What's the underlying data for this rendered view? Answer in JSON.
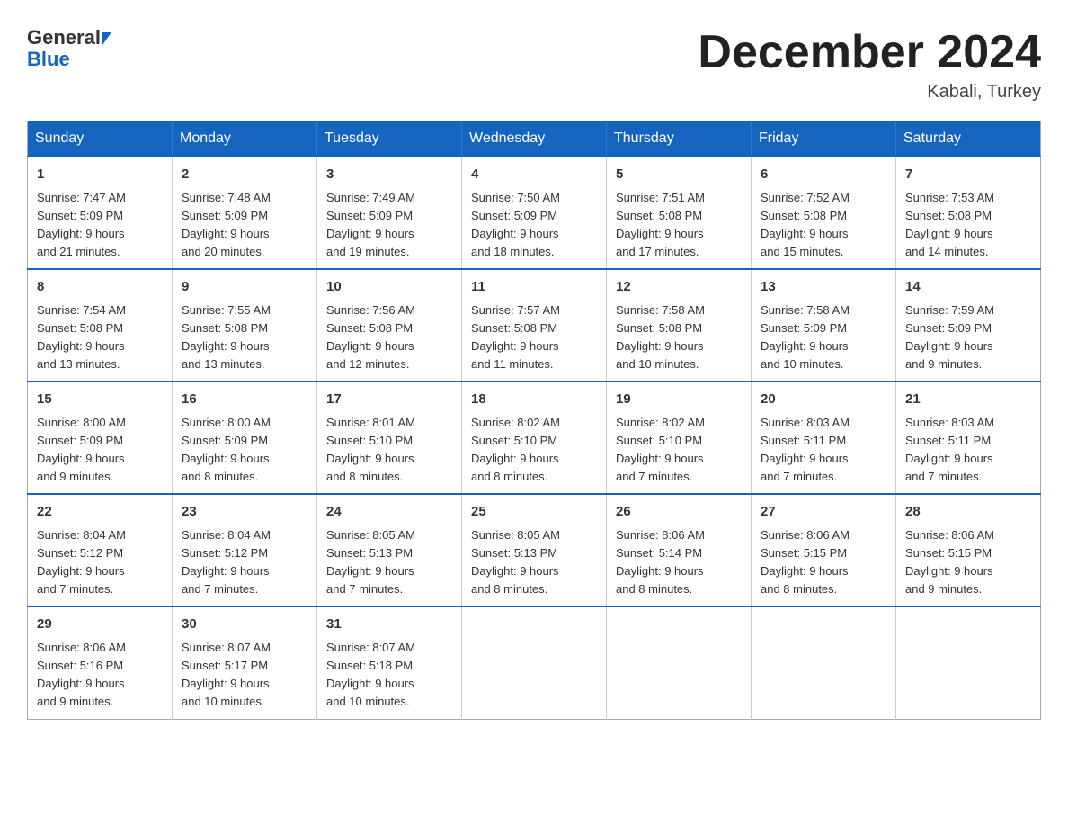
{
  "header": {
    "logo_general": "General",
    "logo_blue": "Blue",
    "month_title": "December 2024",
    "location": "Kabali, Turkey"
  },
  "days_of_week": [
    "Sunday",
    "Monday",
    "Tuesday",
    "Wednesday",
    "Thursday",
    "Friday",
    "Saturday"
  ],
  "weeks": [
    [
      {
        "day": "1",
        "sunrise": "7:47 AM",
        "sunset": "5:09 PM",
        "daylight": "9 hours and 21 minutes."
      },
      {
        "day": "2",
        "sunrise": "7:48 AM",
        "sunset": "5:09 PM",
        "daylight": "9 hours and 20 minutes."
      },
      {
        "day": "3",
        "sunrise": "7:49 AM",
        "sunset": "5:09 PM",
        "daylight": "9 hours and 19 minutes."
      },
      {
        "day": "4",
        "sunrise": "7:50 AM",
        "sunset": "5:09 PM",
        "daylight": "9 hours and 18 minutes."
      },
      {
        "day": "5",
        "sunrise": "7:51 AM",
        "sunset": "5:08 PM",
        "daylight": "9 hours and 17 minutes."
      },
      {
        "day": "6",
        "sunrise": "7:52 AM",
        "sunset": "5:08 PM",
        "daylight": "9 hours and 15 minutes."
      },
      {
        "day": "7",
        "sunrise": "7:53 AM",
        "sunset": "5:08 PM",
        "daylight": "9 hours and 14 minutes."
      }
    ],
    [
      {
        "day": "8",
        "sunrise": "7:54 AM",
        "sunset": "5:08 PM",
        "daylight": "9 hours and 13 minutes."
      },
      {
        "day": "9",
        "sunrise": "7:55 AM",
        "sunset": "5:08 PM",
        "daylight": "9 hours and 13 minutes."
      },
      {
        "day": "10",
        "sunrise": "7:56 AM",
        "sunset": "5:08 PM",
        "daylight": "9 hours and 12 minutes."
      },
      {
        "day": "11",
        "sunrise": "7:57 AM",
        "sunset": "5:08 PM",
        "daylight": "9 hours and 11 minutes."
      },
      {
        "day": "12",
        "sunrise": "7:58 AM",
        "sunset": "5:08 PM",
        "daylight": "9 hours and 10 minutes."
      },
      {
        "day": "13",
        "sunrise": "7:58 AM",
        "sunset": "5:09 PM",
        "daylight": "9 hours and 10 minutes."
      },
      {
        "day": "14",
        "sunrise": "7:59 AM",
        "sunset": "5:09 PM",
        "daylight": "9 hours and 9 minutes."
      }
    ],
    [
      {
        "day": "15",
        "sunrise": "8:00 AM",
        "sunset": "5:09 PM",
        "daylight": "9 hours and 9 minutes."
      },
      {
        "day": "16",
        "sunrise": "8:00 AM",
        "sunset": "5:09 PM",
        "daylight": "9 hours and 8 minutes."
      },
      {
        "day": "17",
        "sunrise": "8:01 AM",
        "sunset": "5:10 PM",
        "daylight": "9 hours and 8 minutes."
      },
      {
        "day": "18",
        "sunrise": "8:02 AM",
        "sunset": "5:10 PM",
        "daylight": "9 hours and 8 minutes."
      },
      {
        "day": "19",
        "sunrise": "8:02 AM",
        "sunset": "5:10 PM",
        "daylight": "9 hours and 7 minutes."
      },
      {
        "day": "20",
        "sunrise": "8:03 AM",
        "sunset": "5:11 PM",
        "daylight": "9 hours and 7 minutes."
      },
      {
        "day": "21",
        "sunrise": "8:03 AM",
        "sunset": "5:11 PM",
        "daylight": "9 hours and 7 minutes."
      }
    ],
    [
      {
        "day": "22",
        "sunrise": "8:04 AM",
        "sunset": "5:12 PM",
        "daylight": "9 hours and 7 minutes."
      },
      {
        "day": "23",
        "sunrise": "8:04 AM",
        "sunset": "5:12 PM",
        "daylight": "9 hours and 7 minutes."
      },
      {
        "day": "24",
        "sunrise": "8:05 AM",
        "sunset": "5:13 PM",
        "daylight": "9 hours and 7 minutes."
      },
      {
        "day": "25",
        "sunrise": "8:05 AM",
        "sunset": "5:13 PM",
        "daylight": "9 hours and 8 minutes."
      },
      {
        "day": "26",
        "sunrise": "8:06 AM",
        "sunset": "5:14 PM",
        "daylight": "9 hours and 8 minutes."
      },
      {
        "day": "27",
        "sunrise": "8:06 AM",
        "sunset": "5:15 PM",
        "daylight": "9 hours and 8 minutes."
      },
      {
        "day": "28",
        "sunrise": "8:06 AM",
        "sunset": "5:15 PM",
        "daylight": "9 hours and 9 minutes."
      }
    ],
    [
      {
        "day": "29",
        "sunrise": "8:06 AM",
        "sunset": "5:16 PM",
        "daylight": "9 hours and 9 minutes."
      },
      {
        "day": "30",
        "sunrise": "8:07 AM",
        "sunset": "5:17 PM",
        "daylight": "9 hours and 10 minutes."
      },
      {
        "day": "31",
        "sunrise": "8:07 AM",
        "sunset": "5:18 PM",
        "daylight": "9 hours and 10 minutes."
      },
      null,
      null,
      null,
      null
    ]
  ],
  "labels": {
    "sunrise": "Sunrise:",
    "sunset": "Sunset:",
    "daylight": "Daylight:"
  }
}
